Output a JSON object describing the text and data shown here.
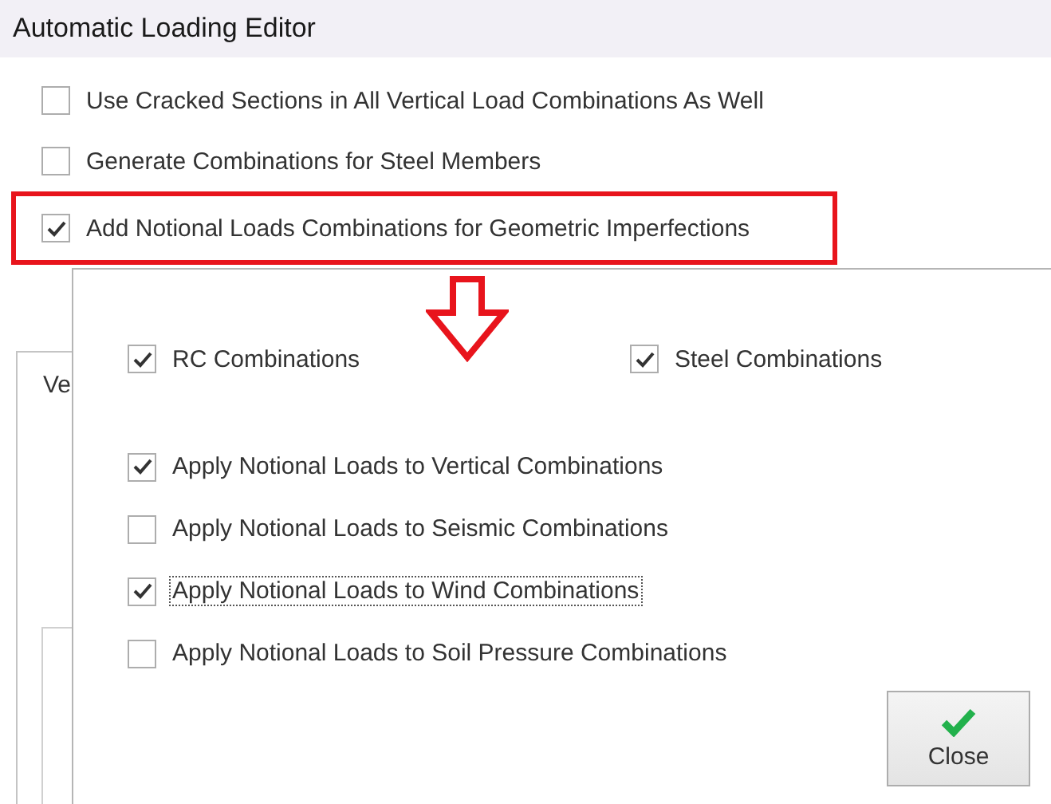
{
  "window": {
    "title": "Automatic Loading Editor"
  },
  "options": [
    {
      "label": "Use Cracked Sections in All Vertical Load Combinations As Well",
      "checked": false,
      "highlighted": false
    },
    {
      "label": "Generate Combinations for Steel Members",
      "checked": false,
      "highlighted": false
    },
    {
      "label": "Add Notional Loads Combinations for Geometric Imperfections",
      "checked": true,
      "highlighted": true
    }
  ],
  "background_panel": {
    "label": "Ve"
  },
  "popup": {
    "top_options": [
      {
        "label": "RC Combinations",
        "checked": true
      },
      {
        "label": "Steel Combinations",
        "checked": true
      }
    ],
    "options": [
      {
        "label": "Apply Notional Loads to Vertical Combinations",
        "checked": true,
        "focused": false
      },
      {
        "label": "Apply Notional Loads to Seismic Combinations",
        "checked": false,
        "focused": false
      },
      {
        "label": "Apply Notional Loads to Wind Combinations",
        "checked": true,
        "focused": true
      },
      {
        "label": "Apply Notional Loads to Soil Pressure Combinations",
        "checked": false,
        "focused": false
      }
    ],
    "close_button": {
      "label": "Close"
    }
  }
}
